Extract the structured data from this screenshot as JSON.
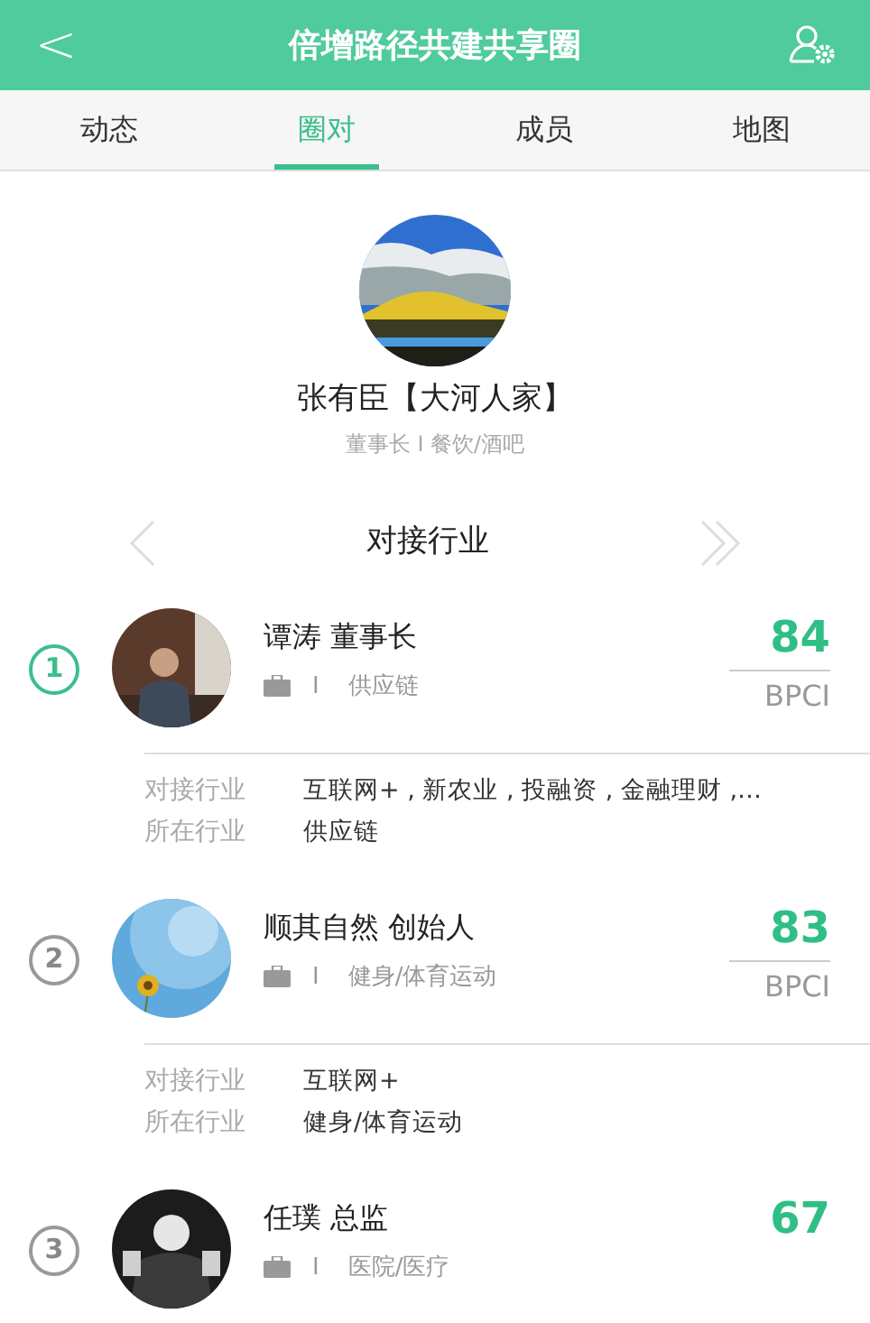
{
  "header": {
    "back": "<",
    "title": "倍增路径共建共享圈"
  },
  "tabs": [
    {
      "label": "动态",
      "selected": false
    },
    {
      "label": "圈对",
      "selected": true
    },
    {
      "label": "成员",
      "selected": false
    },
    {
      "label": "地图",
      "selected": false
    }
  ],
  "profile": {
    "avatar": {
      "kind": "picture"
    },
    "name": "张有臣【大河人家】",
    "subtitle": "董事长 I 餐饮/酒吧"
  },
  "section": {
    "title": "对接行业"
  },
  "members": [
    {
      "rank": "1",
      "highlighted": true,
      "avatar": {
        "kind": "picture"
      },
      "name": "谭涛 董事长",
      "separator": "I",
      "industry": "供应链",
      "score": "84",
      "score_label": "BPCI",
      "details": [
        {
          "label": "对接行业",
          "value": "互联网+ , 新农业 , 投融资 , 金融理财 ,…"
        },
        {
          "label": "所在行业",
          "value": "供应链"
        }
      ]
    },
    {
      "rank": "2",
      "highlighted": false,
      "avatar": {
        "kind": "picture"
      },
      "name": "顺其自然 创始人",
      "separator": "I",
      "industry": "健身/体育运动",
      "score": "83",
      "score_label": "BPCI",
      "details": [
        {
          "label": "对接行业",
          "value": "互联网+"
        },
        {
          "label": "所在行业",
          "value": "健身/体育运动"
        }
      ]
    },
    {
      "rank": "3",
      "highlighted": false,
      "avatar": {
        "kind": "picture"
      },
      "name": "任璞 总监",
      "separator": "I",
      "industry": "医院/医疗",
      "score": "67"
    }
  ]
}
